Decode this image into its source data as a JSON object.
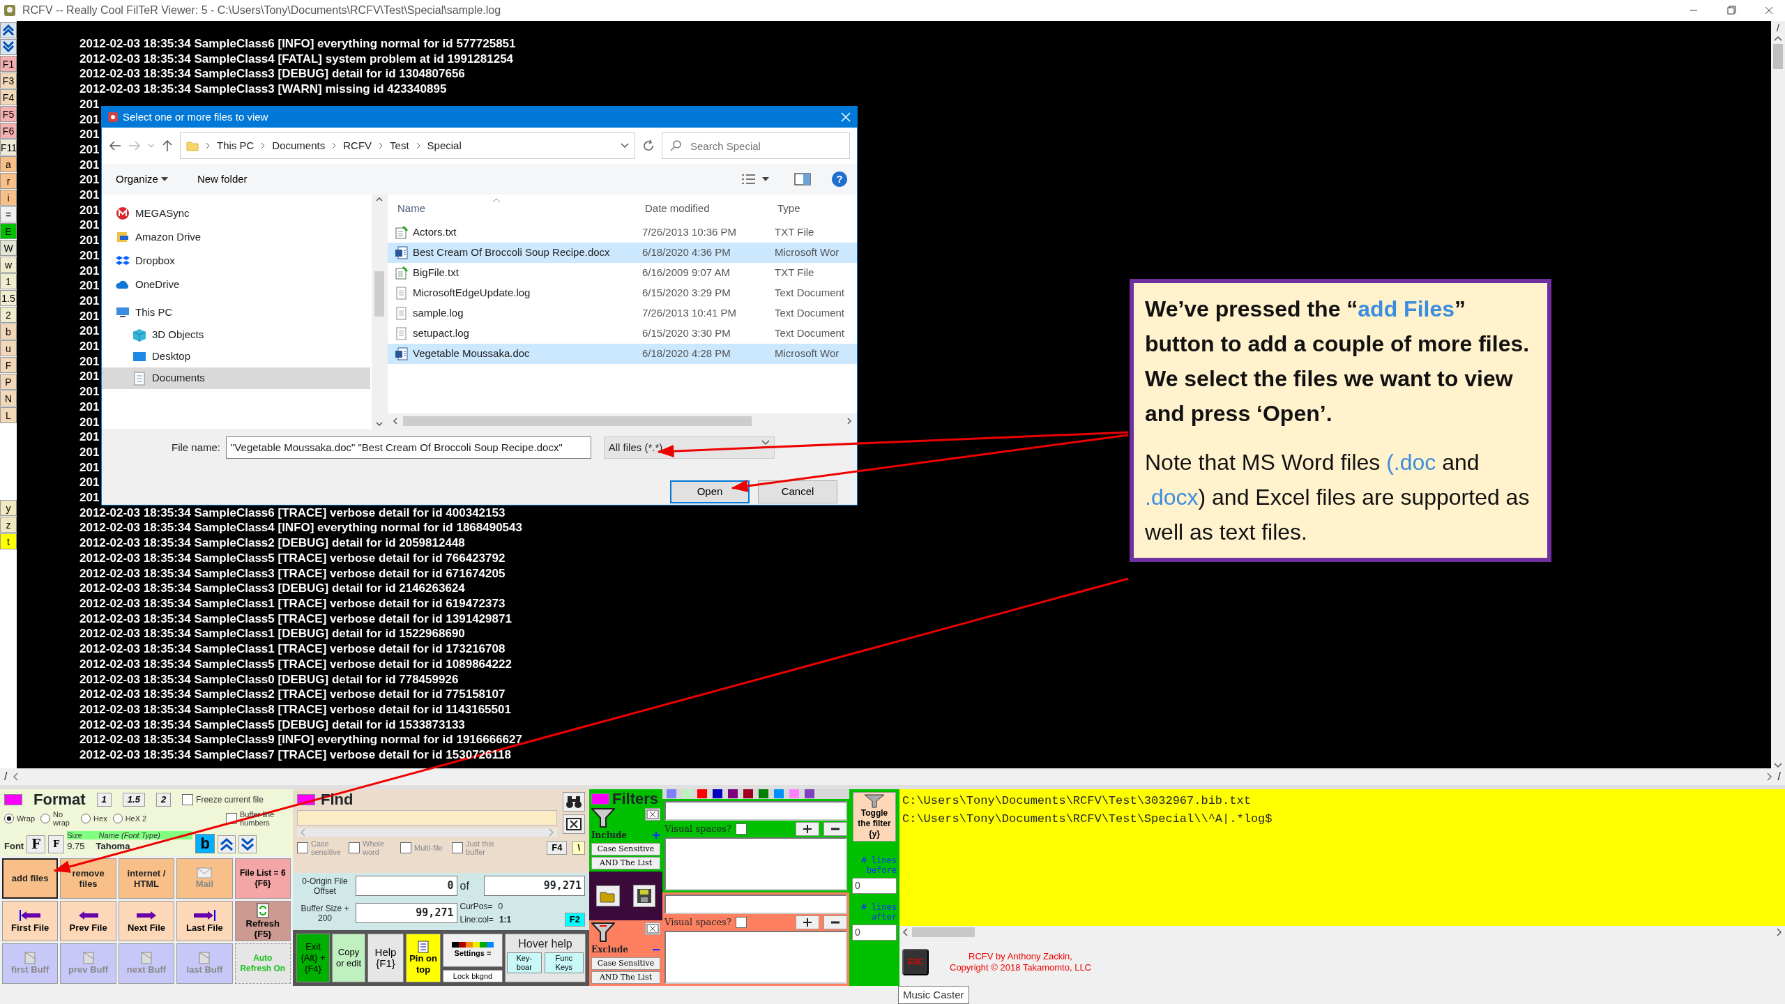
{
  "window": {
    "title": "RCFV -- Really Cool FilTeR Viewer: 5 - C:\\Users\\Tony\\Documents\\RCFV\\Test\\Special\\sample.log"
  },
  "side_toolbar_top": [
    {
      "kind": "up",
      "color": "#d8e4f0"
    },
    {
      "kind": "down",
      "color": "#d8e4f0"
    },
    {
      "label": "F1",
      "kind": "key",
      "color": "#f4b0b0"
    },
    {
      "label": "F3",
      "kind": "key",
      "color": "#f0d8b8"
    },
    {
      "label": "F4",
      "kind": "key",
      "color": "#f0d8b8"
    },
    {
      "label": "F5",
      "kind": "key",
      "color": "#f4b0b0"
    },
    {
      "label": "F6",
      "kind": "key",
      "color": "#f4b0b0"
    },
    {
      "label": "F11",
      "kind": "key",
      "color": "#f0ecd8"
    },
    {
      "label": "a",
      "kind": "key",
      "color": "#f8c088"
    },
    {
      "label": "r",
      "kind": "key",
      "color": "#f8c088"
    },
    {
      "label": "i",
      "kind": "key",
      "color": "#f8c088"
    },
    {
      "label": "=",
      "kind": "key",
      "color": "#f0f0f0"
    },
    {
      "label": "E",
      "kind": "key",
      "color": "#00c000"
    },
    {
      "label": "W",
      "kind": "key",
      "color": "#e4e4d4"
    },
    {
      "label": "w",
      "kind": "key",
      "color": "#f0ecd0"
    },
    {
      "label": "1",
      "kind": "key",
      "color": "#f0ecd0"
    },
    {
      "label": "1.5",
      "kind": "key",
      "color": "#f0ecd0"
    },
    {
      "label": "2",
      "kind": "key",
      "color": "#f0ecd0"
    },
    {
      "label": "b",
      "kind": "key",
      "color": "#f0d8b8"
    },
    {
      "label": "u",
      "kind": "key",
      "color": "#f0d8b8"
    },
    {
      "label": "F",
      "kind": "key",
      "color": "#f0d8b8"
    },
    {
      "label": "P",
      "kind": "key",
      "color": "#f0d8b8"
    },
    {
      "label": "N",
      "kind": "key",
      "color": "#f0d8b8"
    },
    {
      "label": "L",
      "kind": "key",
      "color": "#f0d8b8"
    }
  ],
  "side_toolbar_bottom": [
    {
      "label": "y",
      "kind": "key",
      "color": "#f0e8c0"
    },
    {
      "label": "z",
      "kind": "key",
      "color": "#f0e8c0"
    },
    {
      "label": "t",
      "kind": "key",
      "color": "#ffff00"
    }
  ],
  "log_lines": [
    "2012-02-03 18:35:34 SampleClass6 [INFO] everything normal for id 577725851",
    "2012-02-03 18:35:34 SampleClass4 [FATAL] system problem at id 1991281254",
    "2012-02-03 18:35:34 SampleClass3 [DEBUG] detail for id 1304807656",
    "2012-02-03 18:35:34 SampleClass3 [WARN] missing id 423340895",
    "201",
    "201",
    "201",
    "201",
    "201",
    "201",
    "201",
    "201",
    "201",
    "201",
    "201",
    "201",
    "201",
    "201",
    "201",
    "201",
    "201",
    "201",
    "201",
    "201",
    "201",
    "201",
    "201",
    "201",
    "201",
    "201",
    "201",
    "2012-02-03 18:35:34 SampleClass6 [TRACE] verbose detail for id 400342153",
    "2012-02-03 18:35:34 SampleClass4 [INFO] everything normal for id 1868490543",
    "2012-02-03 18:35:34 SampleClass2 [DEBUG] detail for id 2059812448",
    "2012-02-03 18:35:34 SampleClass5 [TRACE] verbose detail for id 766423792",
    "2012-02-03 18:35:34 SampleClass3 [TRACE] verbose detail for id 671674205",
    "2012-02-03 18:35:34 SampleClass3 [DEBUG] detail for id 2146263624",
    "2012-02-03 18:35:34 SampleClass1 [TRACE] verbose detail for id 619472373",
    "2012-02-03 18:35:34 SampleClass5 [TRACE] verbose detail for id 1391429871",
    "2012-02-03 18:35:34 SampleClass1 [DEBUG] detail for id 1522968690",
    "2012-02-03 18:35:34 SampleClass1 [TRACE] verbose detail for id 173216708",
    "2012-02-03 18:35:34 SampleClass5 [TRACE] verbose detail for id 1089864222",
    "2012-02-03 18:35:34 SampleClass0 [DEBUG] detail for id 778459926",
    "2012-02-03 18:35:34 SampleClass2 [TRACE] verbose detail for id 775158107",
    "2012-02-03 18:35:34 SampleClass8 [TRACE] verbose detail for id 1143165501",
    "2012-02-03 18:35:34 SampleClass5 [DEBUG] detail for id 1533873133",
    "2012-02-03 18:35:34 SampleClass9 [INFO] everything normal for id 1916666627",
    "2012-02-03 18:35:34 SampleClass7 [TRACE] verbose detail for id 1530726118"
  ],
  "scroll_marks": [
    "/",
    "/",
    "/"
  ],
  "dialog": {
    "title": "Select one or more files to view",
    "breadcrumb": [
      "This PC",
      "Documents",
      "RCFV",
      "Test",
      "Special"
    ],
    "search_placeholder": "Search Special",
    "toolbar": [
      "Organize",
      "New folder"
    ],
    "help": "?",
    "nav_items": [
      {
        "label": "MEGASync",
        "kind": "mega",
        "selected": false
      },
      {
        "label": "Amazon Drive",
        "kind": "amazon",
        "selected": false
      },
      {
        "label": "Dropbox",
        "kind": "dropbox",
        "selected": false
      },
      {
        "label": "OneDrive",
        "kind": "cloud",
        "selected": false
      },
      {
        "label": "This PC",
        "kind": "pc",
        "selected": false,
        "children": [
          {
            "label": "3D Objects",
            "kind": "cube",
            "selected": false
          },
          {
            "label": "Desktop",
            "kind": "desktop",
            "selected": false
          },
          {
            "label": "Documents",
            "kind": "docs",
            "selected": true
          }
        ]
      }
    ],
    "columns": [
      "Name",
      "Date modified",
      "Type"
    ],
    "files": [
      {
        "name": "Actors.txt",
        "date": "7/26/2013 10:36 PM",
        "type": "TXT File",
        "kind": "txt",
        "selected": false
      },
      {
        "name": "Best Cream Of Broccoli Soup Recipe.docx",
        "date": "6/18/2020 4:36 PM",
        "type": "Microsoft Wor",
        "kind": "word",
        "selected": true
      },
      {
        "name": "BigFile.txt",
        "date": "6/16/2009 9:07 AM",
        "type": "TXT File",
        "kind": "txt",
        "selected": false
      },
      {
        "name": "MicrosoftEdgeUpdate.log",
        "date": "6/15/2020 3:29 PM",
        "type": "Text Document",
        "kind": "log",
        "selected": false
      },
      {
        "name": "sample.log",
        "date": "7/26/2013 10:41 PM",
        "type": "Text Document",
        "kind": "log",
        "selected": false
      },
      {
        "name": "setupact.log",
        "date": "6/15/2020 3:30 PM",
        "type": "Text Document",
        "kind": "log",
        "selected": false
      },
      {
        "name": "Vegetable Moussaka.doc",
        "date": "6/18/2020 4:28 PM",
        "type": "Microsoft Wor",
        "kind": "word",
        "selected": true
      }
    ],
    "file_name_label": "File name:",
    "file_name_value": "\"Vegetable Moussaka.doc\" \"Best Cream Of Broccoli Soup Recipe.docx\"",
    "file_type": "All files (*.*)",
    "buttons": [
      "Open",
      "Cancel"
    ]
  },
  "callout": {
    "paragraphs": [
      {
        "bold": true,
        "parts": [
          {
            "text": "We’ve pressed the “",
            "highlight": false
          },
          {
            "text": "add Files",
            "highlight": true
          },
          {
            "text": "” button to add a couple of more files. We select the files we want to view and press ‘Open’.",
            "highlight": false
          }
        ]
      },
      {
        "bold": false,
        "parts": [
          {
            "text": "Note that MS Word files ",
            "highlight": false
          },
          {
            "text": "(.doc",
            "highlight": true
          },
          {
            "text": " and ",
            "highlight": false
          },
          {
            "text": ".docx",
            "highlight": true
          },
          {
            "text": ") and Excel files are supported as well as text files.",
            "highlight": false
          }
        ]
      }
    ]
  },
  "format": {
    "title": "Format",
    "spacing": [
      "1",
      "1.5",
      "2"
    ],
    "freeze": {
      "label": "Freeze current file",
      "checked": false
    },
    "buffer_lines": {
      "label": "Buffer line numbers",
      "checked": false
    },
    "wrap_modes": [
      {
        "label": "Wrap",
        "selected": true
      },
      {
        "label": "No wrap",
        "selected": false
      },
      {
        "label": "Hex",
        "selected": false
      },
      {
        "label": "HeX 2",
        "selected": false
      }
    ],
    "font_label": "Font",
    "font_buttons": [
      "F",
      "F"
    ],
    "size_label": "Size",
    "name_label": "Name (Font Type)",
    "size_value": "9.75",
    "font_name": "Tahoma",
    "bold_button": "b"
  },
  "file_buttons": [
    {
      "label": "add files",
      "kind": "action",
      "disabled": false
    },
    {
      "label": "remove files",
      "kind": "action",
      "disabled": false
    },
    {
      "label": "internet / HTML",
      "kind": "action",
      "disabled": false
    },
    {
      "label": "Mail",
      "kind": "mail",
      "disabled": true
    },
    {
      "label": "File List = 6 {F6}",
      "kind": "list",
      "disabled": false
    },
    {
      "label": "First File",
      "kind": "nav",
      "disabled": false
    },
    {
      "label": "Prev File",
      "kind": "nav",
      "disabled": false
    },
    {
      "label": "Next File",
      "kind": "nav",
      "disabled": false
    },
    {
      "label": "Last File",
      "kind": "nav",
      "disabled": false
    },
    {
      "label": "Refresh {F5}",
      "kind": "refresh",
      "disabled": false
    },
    {
      "label": "first Buff",
      "kind": "buff",
      "disabled": true
    },
    {
      "label": "prev Buff",
      "kind": "buff",
      "disabled": true
    },
    {
      "label": "next Buff",
      "kind": "buff",
      "disabled": true
    },
    {
      "label": "last Buff",
      "kind": "buff",
      "disabled": true
    },
    {
      "label": "Auto Refresh On",
      "kind": "auto",
      "disabled": false
    }
  ],
  "find": {
    "title": "Find",
    "options": [
      {
        "label": "Case sensitive",
        "checked": false
      },
      {
        "label": "Whole word",
        "checked": false
      },
      {
        "label": "Multi-file",
        "checked": false
      },
      {
        "label": "Just this buffer",
        "checked": false
      }
    ],
    "f4": "F4",
    "backslash": "\\"
  },
  "offset": {
    "offset_label": "0-Origin File Offset",
    "offset_value": "0",
    "of_label": "of",
    "total": "99,271",
    "buffer_label": "Buffer Size + 200",
    "buffer_value": "99,271",
    "curpos_label": "CurPos=",
    "curpos_value": "0",
    "linecol_label": "Line:col=",
    "linecol_value": "1:1",
    "f2": "F2"
  },
  "actions": [
    {
      "label": "Exit {Alt} + {F4}",
      "kind": "exit"
    },
    {
      "label": "Copy or edit",
      "kind": "copy"
    },
    {
      "label": "Help {F1}",
      "kind": "help"
    },
    {
      "label": "Pin on top",
      "kind": "pin"
    },
    {
      "label": "Settings =",
      "kind": "settings"
    }
  ],
  "lock": "Lock bkgnd",
  "hover_help": {
    "title": "Hover help",
    "buttons": [
      "Key-boar",
      "Func Keys"
    ]
  },
  "filters": {
    "title": "Filters",
    "palette": [
      {
        "color": "#8080ff"
      },
      {
        "color": "#c0f0c0"
      },
      {
        "color": "#ff0000"
      },
      {
        "color": "#0000c0"
      },
      {
        "color": "#800080"
      },
      {
        "color": "#a00020"
      },
      {
        "color": "#008000"
      },
      {
        "color": "#0090ff"
      },
      {
        "color": "#ff80ff"
      },
      {
        "color": "#8040c0"
      }
    ],
    "groups": [
      {
        "kind": "include",
        "label": "Include",
        "sign": "+",
        "case": "Case Sensitive",
        "and": "AND The List",
        "visual": "Visual spaces?",
        "visual_checked": false
      },
      {
        "kind": "exclude",
        "label": "Exclude",
        "sign": "−",
        "case": "Case Sensitive",
        "and": "AND The List",
        "visual": "Visual spaces?",
        "visual_checked": false
      }
    ]
  },
  "toggle": {
    "label": "Toggle the filter {y}",
    "before_label": "# lines before",
    "before_value": "0",
    "after_label": "# lines after",
    "after_value": "0"
  },
  "file_list": [
    "C:\\Users\\Tony\\Documents\\RCFV\\Test\\3032967.bib.txt",
    "C:\\Users\\Tony\\Documents\\RCFV\\Test\\Special\\\\^A|.*log$"
  ],
  "footer": {
    "esc": "ESC",
    "credits": [
      "RCFV by Anthony Zackin,",
      "Copyright © 2018 Takamomto, LLC"
    ]
  },
  "tooltip": "Music Caster"
}
